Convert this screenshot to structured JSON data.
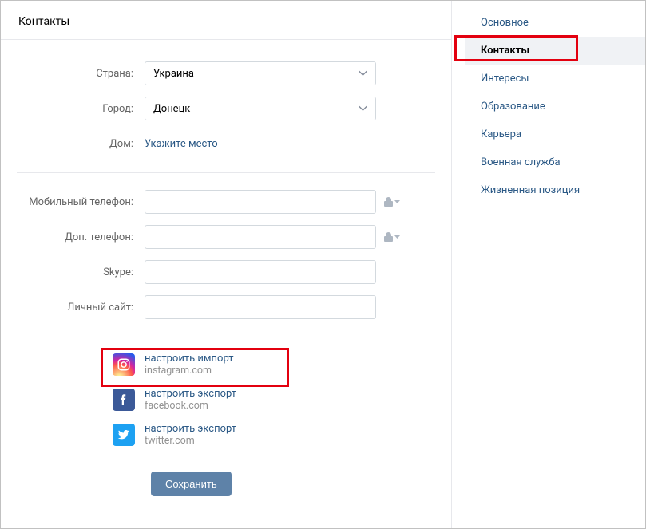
{
  "header": {
    "title": "Контакты"
  },
  "form": {
    "country_label": "Страна:",
    "country_value": "Украина",
    "city_label": "Город:",
    "city_value": "Донецк",
    "home_label": "Дом:",
    "home_link": "Укажите место",
    "mobile_label": "Мобильный телефон:",
    "mobile_value": "",
    "extra_label": "Доп. телефон:",
    "extra_value": "",
    "skype_label": "Skype:",
    "skype_value": "",
    "site_label": "Личный сайт:",
    "site_value": ""
  },
  "socials": {
    "ig_label": "настроить импорт",
    "ig_domain": "instagram.com",
    "fb_label": "настроить экспорт",
    "fb_domain": "facebook.com",
    "tw_label": "настроить экспорт",
    "tw_domain": "twitter.com"
  },
  "save_label": "Сохранить",
  "sidebar": {
    "main": "Основное",
    "contacts": "Контакты",
    "interests": "Интересы",
    "education": "Образование",
    "career": "Карьера",
    "military": "Военная служба",
    "life": "Жизненная позиция"
  }
}
